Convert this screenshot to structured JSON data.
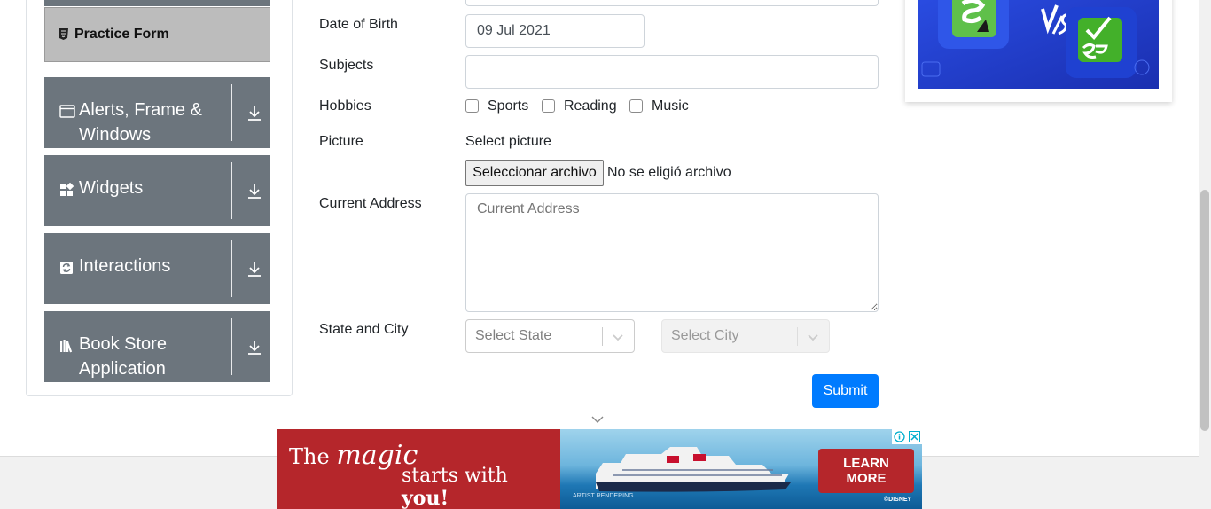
{
  "sidebar": {
    "active_item": "Practice Form",
    "groups": [
      {
        "label_line1": "Alerts, Frame &",
        "label_line2": "Windows",
        "icon": "window-icon"
      },
      {
        "label_line1": "Widgets",
        "label_line2": "",
        "icon": "widgets-icon"
      },
      {
        "label_line1": "Interactions",
        "label_line2": "",
        "icon": "interactions-icon"
      },
      {
        "label_line1": "Book Store",
        "label_line2": "Application",
        "icon": "books-icon"
      }
    ]
  },
  "form": {
    "dob_label": "Date of Birth",
    "dob_value": "09 Jul 2021",
    "subjects_label": "Subjects",
    "subjects_value": "",
    "hobbies_label": "Hobbies",
    "hobbies": [
      {
        "label": "Sports",
        "checked": false
      },
      {
        "label": "Reading",
        "checked": false
      },
      {
        "label": "Music",
        "checked": false
      }
    ],
    "picture_label": "Picture",
    "select_picture": "Select picture",
    "file_button": "Seleccionar archivo",
    "file_status": "No se eligió archivo",
    "address_label": "Current Address",
    "address_placeholder": "Current Address",
    "state_city_label": "State and City",
    "state_placeholder": "Select State",
    "city_placeholder": "Select City",
    "submit_label": "Submit"
  },
  "bottom_ad": {
    "line1_plain": "The",
    "line1_script": "magic",
    "line2_plain": "starts with",
    "line2_bold": "you!",
    "button_line1": "LEARN",
    "button_line2": "MORE",
    "caption_left": "ARTIST RENDERING",
    "caption_right": "©DISNEY"
  },
  "colors": {
    "primary": "#007bff",
    "sidebar_group": "#6c757d",
    "ad_red": "#b5262b"
  }
}
